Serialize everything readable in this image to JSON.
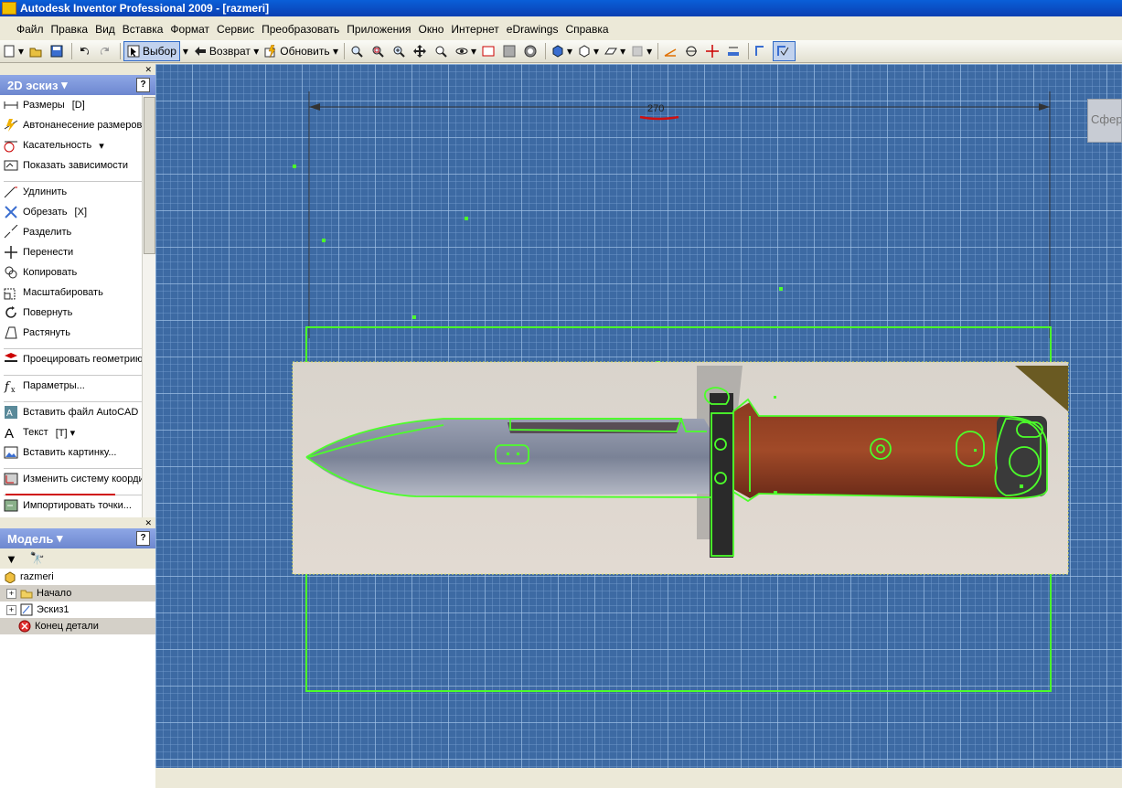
{
  "window": {
    "title": "Autodesk Inventor Professional 2009 - [razmeri]"
  },
  "menu": [
    "Файл",
    "Правка",
    "Вид",
    "Вставка",
    "Формат",
    "Сервис",
    "Преобразовать",
    "Приложения",
    "Окно",
    "Интернет",
    "eDrawings",
    "Справка"
  ],
  "toolbar": {
    "select_label": "Выбор",
    "return_label": "Возврат",
    "update_label": "Обновить"
  },
  "sketch_panel": {
    "title": "2D эскиз",
    "commands": [
      {
        "label": "Размеры",
        "shortcut": "[D]",
        "icon": "dimension-icon"
      },
      {
        "label": "Автонанесение размеров",
        "shortcut": "",
        "icon": "auto-dimension-icon"
      },
      {
        "label": "Касательность",
        "shortcut": "▾",
        "icon": "tangent-icon"
      },
      {
        "label": "Показать зависимости",
        "shortcut": "",
        "icon": "show-constraints-icon"
      },
      {
        "sep": true
      },
      {
        "label": "Удлинить",
        "shortcut": "",
        "icon": "extend-icon"
      },
      {
        "label": "Обрезать",
        "shortcut": "[X]",
        "icon": "trim-icon"
      },
      {
        "label": "Разделить",
        "shortcut": "",
        "icon": "split-icon"
      },
      {
        "label": "Перенести",
        "shortcut": "",
        "icon": "move-icon"
      },
      {
        "label": "Копировать",
        "shortcut": "",
        "icon": "copy-icon"
      },
      {
        "label": "Масштабировать",
        "shortcut": "",
        "icon": "scale-icon"
      },
      {
        "label": "Повернуть",
        "shortcut": "",
        "icon": "rotate-icon"
      },
      {
        "label": "Растянуть",
        "shortcut": "",
        "icon": "stretch-icon"
      },
      {
        "sep": true
      },
      {
        "label": "Проецировать геометрию",
        "shortcut": "",
        "icon": "project-geometry-icon"
      },
      {
        "sep": true
      },
      {
        "label": "Параметры...",
        "shortcut": "",
        "icon": "parameters-icon"
      },
      {
        "sep": true
      },
      {
        "label": "Вставить файл AutoCAD",
        "shortcut": "",
        "icon": "autocad-icon"
      },
      {
        "label": "Текст",
        "shortcut": "[T]   ▾",
        "icon": "text-icon"
      },
      {
        "label": "Вставить картинку...",
        "shortcut": "",
        "icon": "insert-image-icon"
      },
      {
        "sep": true
      },
      {
        "label": "Изменить систему координат",
        "shortcut": "",
        "icon": "coordinate-system-icon"
      },
      {
        "sep": true
      },
      {
        "label": "Импортировать точки...",
        "shortcut": "",
        "icon": "import-points-icon"
      }
    ]
  },
  "model_panel": {
    "title": "Модель",
    "tree": [
      {
        "label": "razmeri",
        "icon": "part-icon",
        "level": 0
      },
      {
        "label": "Начало",
        "icon": "folder-icon",
        "level": 1,
        "expand": "+"
      },
      {
        "label": "Эскиз1",
        "icon": "sketch-icon",
        "level": 1,
        "expand": "+"
      },
      {
        "label": "Конец детали",
        "icon": "end-of-part-icon",
        "level": 1
      }
    ]
  },
  "canvas": {
    "dimension_value": "270",
    "float_button_label": "Сфере"
  },
  "colors": {
    "grid_bg": "#3d6aa3",
    "sketch_line": "#4cff2a",
    "highlight": "#d01010"
  }
}
